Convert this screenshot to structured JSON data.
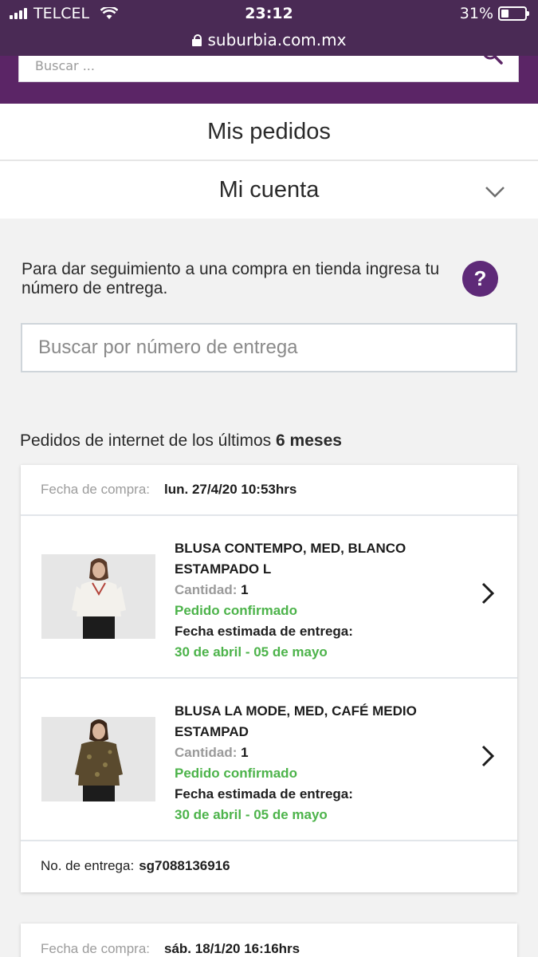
{
  "status_bar": {
    "carrier": "TELCEL",
    "time": "23:12",
    "battery": "31%",
    "battery_level": 0.31
  },
  "browser": {
    "url": "suburbia.com.mx"
  },
  "site_search": {
    "placeholder": "Buscar ..."
  },
  "account_menu": {
    "orders_label": "Mis pedidos",
    "account_label": "Mi cuenta"
  },
  "tracking": {
    "instructions": "Para dar seguimiento a una compra en tienda ingresa tu número de entrega.",
    "help_label": "?",
    "input_placeholder": "Buscar por número de entrega"
  },
  "orders_heading": {
    "prefix": "Pedidos de internet de los últimos",
    "period": "6 meses"
  },
  "orders": [
    {
      "date_label": "Fecha de compra:",
      "date_value": "lun. 27/4/20 10:53hrs",
      "items": [
        {
          "name": "BLUSA CONTEMPO, MED, BLANCO ESTAMPADO L",
          "qty_label": "Cantidad:",
          "qty": "1",
          "status": "Pedido confirmado",
          "eta_label": "Fecha estimada de entrega:",
          "eta": "30 de abril - 05 de mayo"
        },
        {
          "name": "BLUSA LA MODE, MED, CAFÉ MEDIO ESTAMPAD",
          "qty_label": "Cantidad:",
          "qty": "1",
          "status": "Pedido confirmado",
          "eta_label": "Fecha estimada de entrega:",
          "eta": "30 de abril - 05 de mayo"
        }
      ],
      "delivery_label": "No. de entrega:",
      "delivery_number": "sg7088136916"
    },
    {
      "date_label": "Fecha de compra:",
      "date_value": "sáb. 18/1/20 16:16hrs"
    }
  ],
  "colors": {
    "brand_purple": "#5b2566",
    "help_purple": "#5e2a78",
    "status_green": "#4cb34a"
  }
}
